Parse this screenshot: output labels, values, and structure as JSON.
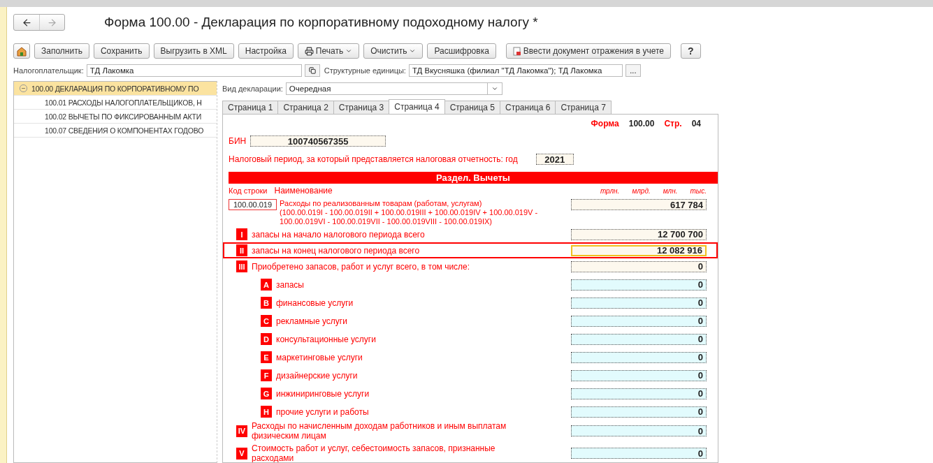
{
  "window": {
    "title": "Форма 100.00 - Декларация по корпоративному подоходному налогу *"
  },
  "toolbar": [
    {
      "label": "Заполнить",
      "kind": "plain"
    },
    {
      "label": "Сохранить",
      "kind": "plain"
    },
    {
      "label": "Выгрузить в XML",
      "kind": "plain"
    },
    {
      "label": "Настройка",
      "kind": "plain"
    },
    {
      "label": "Печать",
      "kind": "print"
    },
    {
      "label": "Очистить",
      "kind": "dropdown"
    },
    {
      "label": "Расшифровка",
      "kind": "plain"
    },
    {
      "label": "Ввести документ отражения в учете",
      "kind": "document"
    },
    {
      "label": "?",
      "kind": "help"
    }
  ],
  "taxpayer": {
    "label": "Налогоплательщик:",
    "value": "ТД Лакомка"
  },
  "units": {
    "label": "Структурные единицы:",
    "value": "ТД Вкусняшка (филиал \"ТД Лакомка\"); ТД Лакомка",
    "button": "..."
  },
  "tree": {
    "items": [
      {
        "label": "100.00 ДЕКЛАРАЦИЯ ПО КОРПОРАТИВНОМУ ПО",
        "selected": true,
        "expanded": true,
        "children": [
          {
            "label": "100.01 РАСХОДЫ НАЛОГОПЛАТЕЛЬЩИКОВ, Н",
            "selected": false
          },
          {
            "label": "100.02 ВЫЧЕТЫ ПО ФИКСИРОВАННЫМ АКТИ",
            "selected": false
          },
          {
            "label": "100.07 СВЕДЕНИЯ О КОМПОНЕНТАХ ГОДОВО",
            "selected": false
          }
        ]
      }
    ]
  },
  "declaration_type": {
    "label": "Вид декларации:",
    "value": "Очередная"
  },
  "tabs": [
    {
      "label": "Страница 1",
      "selected": false
    },
    {
      "label": "Страница 2",
      "selected": false
    },
    {
      "label": "Страница 3",
      "selected": false
    },
    {
      "label": "Страница 4",
      "selected": true
    },
    {
      "label": "Страница 5",
      "selected": false
    },
    {
      "label": "Страница 6",
      "selected": false
    },
    {
      "label": "Страница 7",
      "selected": false
    }
  ],
  "form": {
    "form_label": "Форма",
    "form_number": "100.00",
    "page_label": "Стр.",
    "page_number": "04",
    "bin_label": "БИН",
    "bin": "100740567355",
    "period_label": "Налоговый период, за который представляется налоговая отчетность: год",
    "year": "2021",
    "section_title": "Раздел. Вычеты",
    "code_header": "Код строки",
    "name_header": "Наименование",
    "units": [
      "трлн.",
      "млрд.",
      "млн.",
      "тыс."
    ],
    "main_line": {
      "code": "100.00.019",
      "label": "Расходы по реализованным товарам (работам, услугам)",
      "formula": "(100.00.019I - 100.00.019II + 100.00.019III + 100.00.019IV + 100.00.019V - 100.00.019VI - 100.00.019VII - 100.00.019VIII - 100.00.019IX)",
      "value": "617 784"
    },
    "rows": [
      {
        "mark": "I",
        "label": "запасы на начало налогового периода всего",
        "value": "12 700 700",
        "kind": "main",
        "editable": false,
        "highlighted": false,
        "focused": false
      },
      {
        "mark": "II",
        "label": "запасы на конец налогового периода всего",
        "value": "12 082 916",
        "kind": "main",
        "editable": false,
        "highlighted": true,
        "focused": true
      },
      {
        "mark": "III",
        "label": "Приобретено запасов, работ и услуг всего,  в том числе:",
        "value": "0",
        "kind": "main",
        "editable": false,
        "highlighted": false,
        "focused": false
      },
      {
        "mark": "A",
        "label": "запасы",
        "value": "0",
        "kind": "sub",
        "editable": true,
        "highlighted": false,
        "focused": false
      },
      {
        "mark": "B",
        "label": "финансовые услуги",
        "value": "0",
        "kind": "sub",
        "editable": true,
        "highlighted": false,
        "focused": false
      },
      {
        "mark": "C",
        "label": "рекламные услуги",
        "value": "0",
        "kind": "sub",
        "editable": true,
        "highlighted": false,
        "focused": false
      },
      {
        "mark": "D",
        "label": "консультационные услуги",
        "value": "0",
        "kind": "sub",
        "editable": true,
        "highlighted": false,
        "focused": false
      },
      {
        "mark": "E",
        "label": "маркетинговые услуги",
        "value": "0",
        "kind": "sub",
        "editable": true,
        "highlighted": false,
        "focused": false
      },
      {
        "mark": "F",
        "label": "дизайнерские услуги",
        "value": "0",
        "kind": "sub",
        "editable": true,
        "highlighted": false,
        "focused": false
      },
      {
        "mark": "G",
        "label": "инжиниринговые услуги",
        "value": "0",
        "kind": "sub",
        "editable": true,
        "highlighted": false,
        "focused": false
      },
      {
        "mark": "H",
        "label": "прочие услуги и работы",
        "value": "0",
        "kind": "sub",
        "editable": true,
        "highlighted": false,
        "focused": false
      },
      {
        "mark": "IV",
        "label": "Расходы по начисленным доходам работников и иным выплатам физическим лицам",
        "value": "0",
        "kind": "main",
        "editable": true,
        "highlighted": false,
        "focused": false
      },
      {
        "mark": "V",
        "label": "Стоимость работ и услуг, себестоимость запасов, признанные расходами",
        "value": "0",
        "kind": "main",
        "editable": true,
        "highlighted": false,
        "focused": false
      }
    ]
  }
}
